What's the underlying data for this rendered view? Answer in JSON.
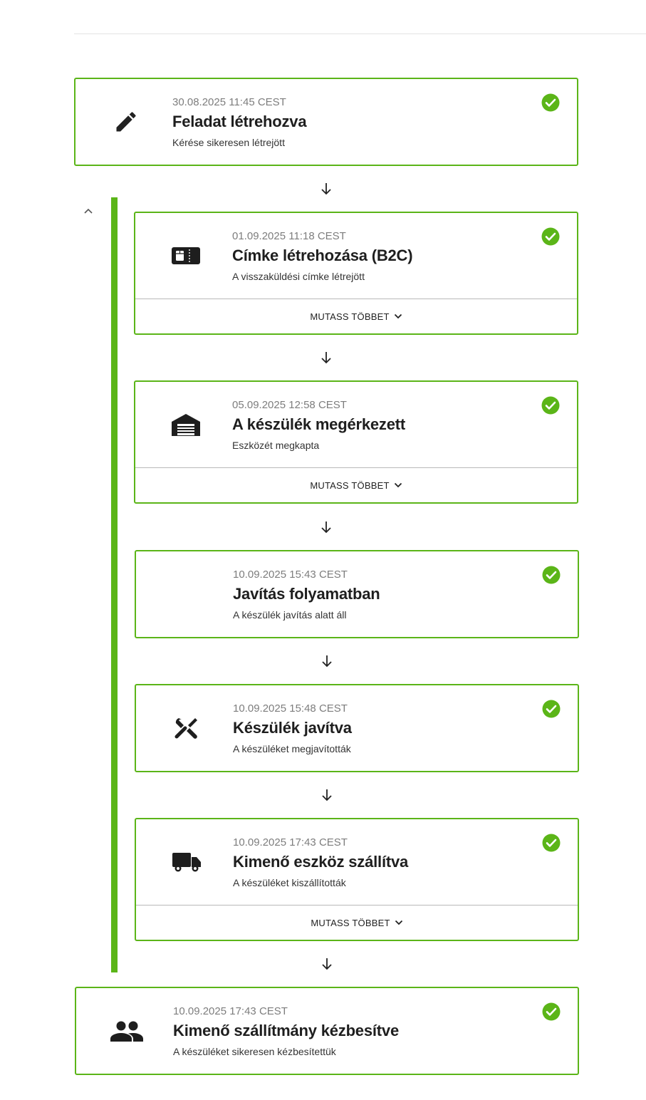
{
  "colors": {
    "accent": "#5bb518",
    "text": "#222222",
    "muted": "#7d7d7d"
  },
  "show_more_label": "MUTASS TÖBBET",
  "steps": [
    {
      "date": "30.08.2025 11:45 CEST",
      "title": "Feladat létrehozva",
      "description": "Kérése sikeresen létrejött",
      "icon": "pencil-icon",
      "status": "completed"
    },
    {
      "date": "01.09.2025 11:18 CEST",
      "title": "Címke létrehozása (B2C)",
      "description": "A visszaküldési címke létrejött",
      "icon": "label-ticket-icon",
      "status": "completed"
    },
    {
      "date": "05.09.2025 12:58 CEST",
      "title": "A készülék megérkezett",
      "description": "Eszközét megkapta",
      "icon": "warehouse-icon",
      "status": "completed"
    },
    {
      "date": "10.09.2025 15:43 CEST",
      "title": "Javítás folyamatban",
      "description": "A készülék javítás alatt áll",
      "icon": "",
      "status": "completed"
    },
    {
      "date": "10.09.2025 15:48 CEST",
      "title": "Készülék javítva",
      "description": "A készüléket megjavították",
      "icon": "tools-icon",
      "status": "completed"
    },
    {
      "date": "10.09.2025 17:43 CEST",
      "title": "Kimenő eszköz szállítva",
      "description": "A készüléket kiszállították",
      "icon": "truck-icon",
      "status": "completed"
    },
    {
      "date": "10.09.2025 17:43 CEST",
      "title": "Kimenő szállítmány kézbesítve",
      "description": "A készüléket sikeresen kézbesítettük",
      "icon": "people-icon",
      "status": "completed"
    }
  ]
}
